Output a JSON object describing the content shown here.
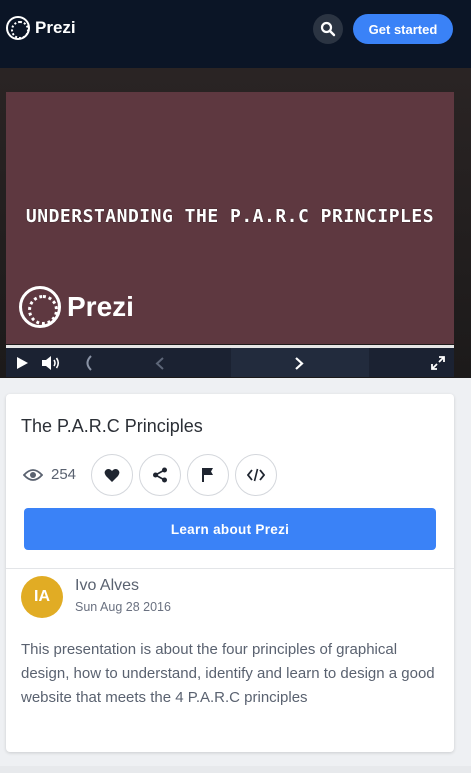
{
  "header": {
    "brand": "Prezi",
    "search_icon": "search-icon",
    "cta_label": "Get started"
  },
  "video": {
    "title": "UNDERSTANDING THE P.A.R.C PRINCIPLES",
    "brand": "Prezi",
    "icons": [
      "play-icon",
      "volume-icon",
      "loading-icon",
      "chevron-left-icon",
      "chevron-right-icon",
      "fullscreen-icon"
    ]
  },
  "presentation": {
    "title": "The P.A.R.C Principles",
    "views": "254",
    "actions": [
      "heart-icon",
      "share-icon",
      "flag-icon",
      "embed-icon"
    ],
    "learn_label": "Learn about Prezi",
    "author_initials": "IA",
    "author_name": "Ivo Alves",
    "date": "Sun Aug 28 2016",
    "description": "This presentation is about the four principles of graphical design, how to understand, identify and learn to design a good website that meets the 4 P.A.R.C principles"
  },
  "colors": {
    "header_bg": "#0b1526",
    "accent": "#3a82f7",
    "slide_bg": "#5e3840",
    "avatar_bg": "#e1ac24"
  }
}
